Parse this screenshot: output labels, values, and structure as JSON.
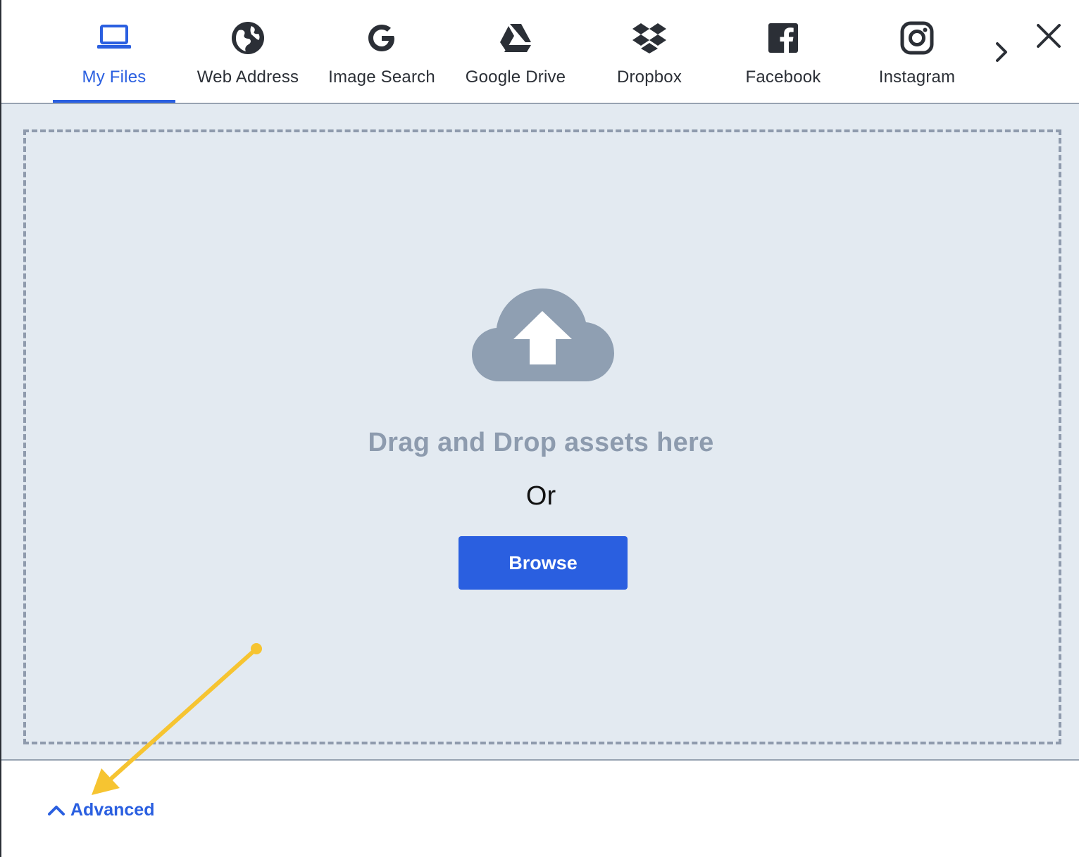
{
  "tabs": [
    {
      "id": "my-files",
      "label": "My Files",
      "icon": "laptop-icon",
      "active": true
    },
    {
      "id": "web-address",
      "label": "Web Address",
      "icon": "globe-icon",
      "active": false
    },
    {
      "id": "image-search",
      "label": "Image Search",
      "icon": "google-icon",
      "active": false
    },
    {
      "id": "google-drive",
      "label": "Google Drive",
      "icon": "google-drive-icon",
      "active": false
    },
    {
      "id": "dropbox",
      "label": "Dropbox",
      "icon": "dropbox-icon",
      "active": false
    },
    {
      "id": "facebook",
      "label": "Facebook",
      "icon": "facebook-icon",
      "active": false
    },
    {
      "id": "instagram",
      "label": "Instagram",
      "icon": "instagram-icon",
      "active": false
    }
  ],
  "header": {
    "next_icon": "chevron-right-icon",
    "close_icon": "close-icon"
  },
  "dropzone": {
    "icon": "cloud-upload-icon",
    "heading": "Drag and Drop assets here",
    "separator": "Or",
    "browse_label": "Browse"
  },
  "footer": {
    "advanced_label": "Advanced",
    "advanced_icon": "chevron-up-icon"
  },
  "colors": {
    "accent": "#2a5fe0",
    "drop_bg": "#e3eaf1",
    "muted": "#8d9bae",
    "annotation_arrow": "#f6c431"
  }
}
